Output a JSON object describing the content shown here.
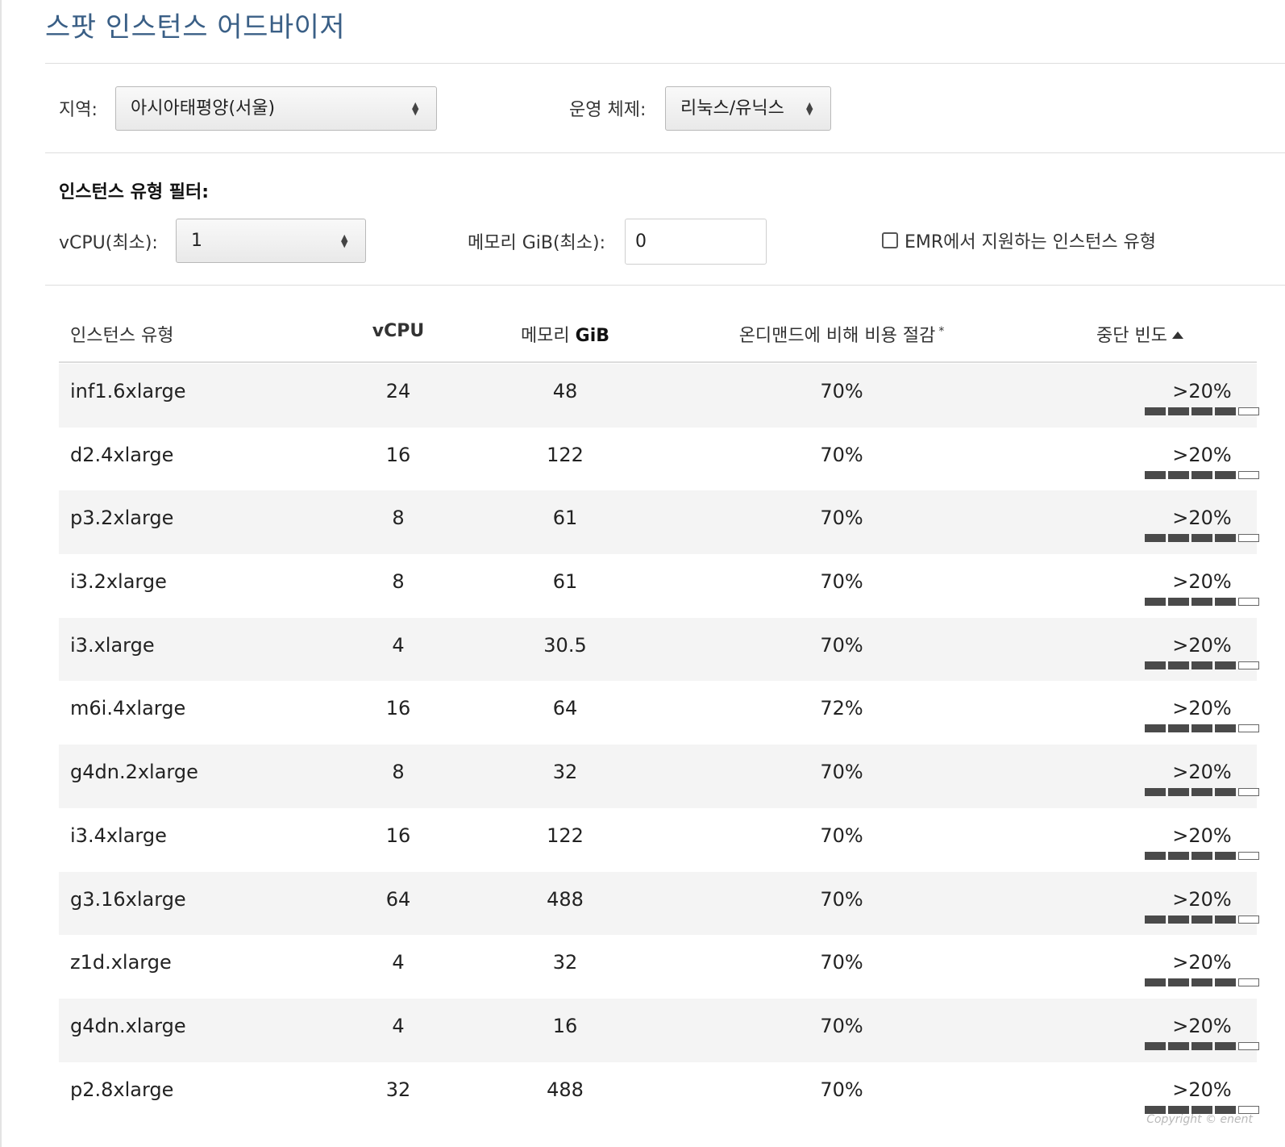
{
  "title": "스팟 인스턴스 어드바이저",
  "filters": {
    "region_label": "지역:",
    "region_value": "아시아태평양(서울)",
    "os_label": "운영 체제:",
    "os_value": "리눅스/유닉스",
    "section_label": "인스턴스 유형 필터:",
    "vcpu_label": "vCPU(최소):",
    "vcpu_value": "1",
    "memory_label": "메모리 GiB(최소):",
    "memory_value": "0",
    "emr_label": "EMR에서 지원하는 인스턴스 유형",
    "emr_checked": false
  },
  "table": {
    "headers": {
      "instance_type": "인스턴스 유형",
      "vcpu": "vCPU",
      "memory_prefix": "메모리",
      "memory_unit": "GiB",
      "savings": "온디맨드에 비해 비용 절감",
      "savings_mark": "*",
      "frequency": "중단 빈도"
    },
    "sort": "frequency ascending",
    "rows": [
      {
        "type": "inf1.6xlarge",
        "vcpu": "24",
        "memory": "48",
        "savings": "70%",
        "frequency": ">20%",
        "level": 4
      },
      {
        "type": "d2.4xlarge",
        "vcpu": "16",
        "memory": "122",
        "savings": "70%",
        "frequency": ">20%",
        "level": 4
      },
      {
        "type": "p3.2xlarge",
        "vcpu": "8",
        "memory": "61",
        "savings": "70%",
        "frequency": ">20%",
        "level": 4
      },
      {
        "type": "i3.2xlarge",
        "vcpu": "8",
        "memory": "61",
        "savings": "70%",
        "frequency": ">20%",
        "level": 4
      },
      {
        "type": "i3.xlarge",
        "vcpu": "4",
        "memory": "30.5",
        "savings": "70%",
        "frequency": ">20%",
        "level": 4
      },
      {
        "type": "m6i.4xlarge",
        "vcpu": "16",
        "memory": "64",
        "savings": "72%",
        "frequency": ">20%",
        "level": 4
      },
      {
        "type": "g4dn.2xlarge",
        "vcpu": "8",
        "memory": "32",
        "savings": "70%",
        "frequency": ">20%",
        "level": 4
      },
      {
        "type": "i3.4xlarge",
        "vcpu": "16",
        "memory": "122",
        "savings": "70%",
        "frequency": ">20%",
        "level": 4
      },
      {
        "type": "g3.16xlarge",
        "vcpu": "64",
        "memory": "488",
        "savings": "70%",
        "frequency": ">20%",
        "level": 4
      },
      {
        "type": "z1d.xlarge",
        "vcpu": "4",
        "memory": "32",
        "savings": "70%",
        "frequency": ">20%",
        "level": 4
      },
      {
        "type": "g4dn.xlarge",
        "vcpu": "4",
        "memory": "16",
        "savings": "70%",
        "frequency": ">20%",
        "level": 4
      },
      {
        "type": "p2.8xlarge",
        "vcpu": "32",
        "memory": "488",
        "savings": "70%",
        "frequency": ">20%",
        "level": 4
      }
    ],
    "level_max": 5
  },
  "copyright": "Copyright © enent"
}
